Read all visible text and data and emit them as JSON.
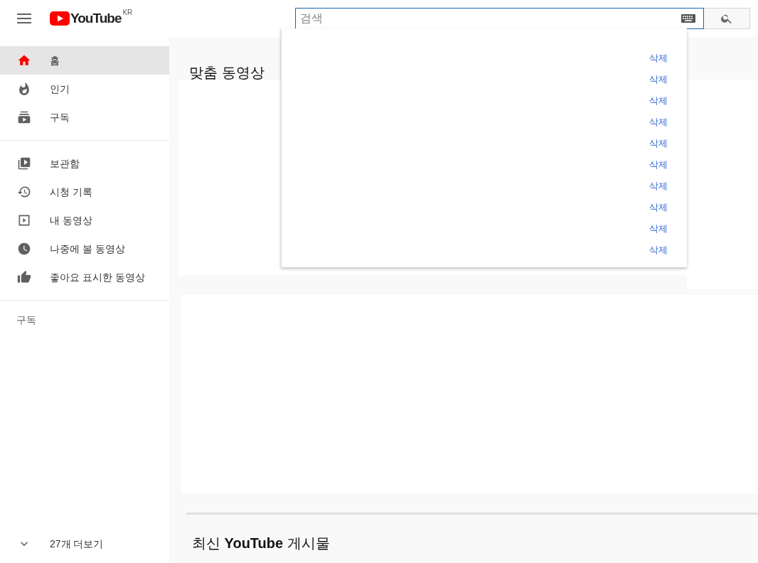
{
  "header": {
    "logo_text": "YouTube",
    "logo_region": "KR",
    "search": {
      "placeholder": "검색"
    }
  },
  "sidebar": {
    "items": [
      {
        "label": "홈",
        "selected": true
      },
      {
        "label": "인기",
        "selected": false
      },
      {
        "label": "구독",
        "selected": false
      }
    ],
    "library": [
      {
        "label": "보관함",
        "selected": false
      },
      {
        "label": "시청 기록",
        "selected": false
      },
      {
        "label": "내 동영상",
        "selected": false
      },
      {
        "label": "나중에 볼 동영상",
        "selected": false
      },
      {
        "label": "좋아요 표시한 동영상",
        "selected": false
      }
    ],
    "subscriptions_heading": "구독",
    "show_more": "27개 더보기"
  },
  "main": {
    "section_title": "맞춤 동영상",
    "posts_title": "최신 **YouTube** 게시물"
  },
  "search_suggestions": [
    {
      "action": "삭제"
    },
    {
      "action": "삭제"
    },
    {
      "action": "삭제"
    },
    {
      "action": "삭제"
    },
    {
      "action": "삭제"
    },
    {
      "action": "삭제"
    },
    {
      "action": "삭제"
    },
    {
      "action": "삭제"
    },
    {
      "action": "삭제"
    },
    {
      "action": "삭제"
    }
  ]
}
